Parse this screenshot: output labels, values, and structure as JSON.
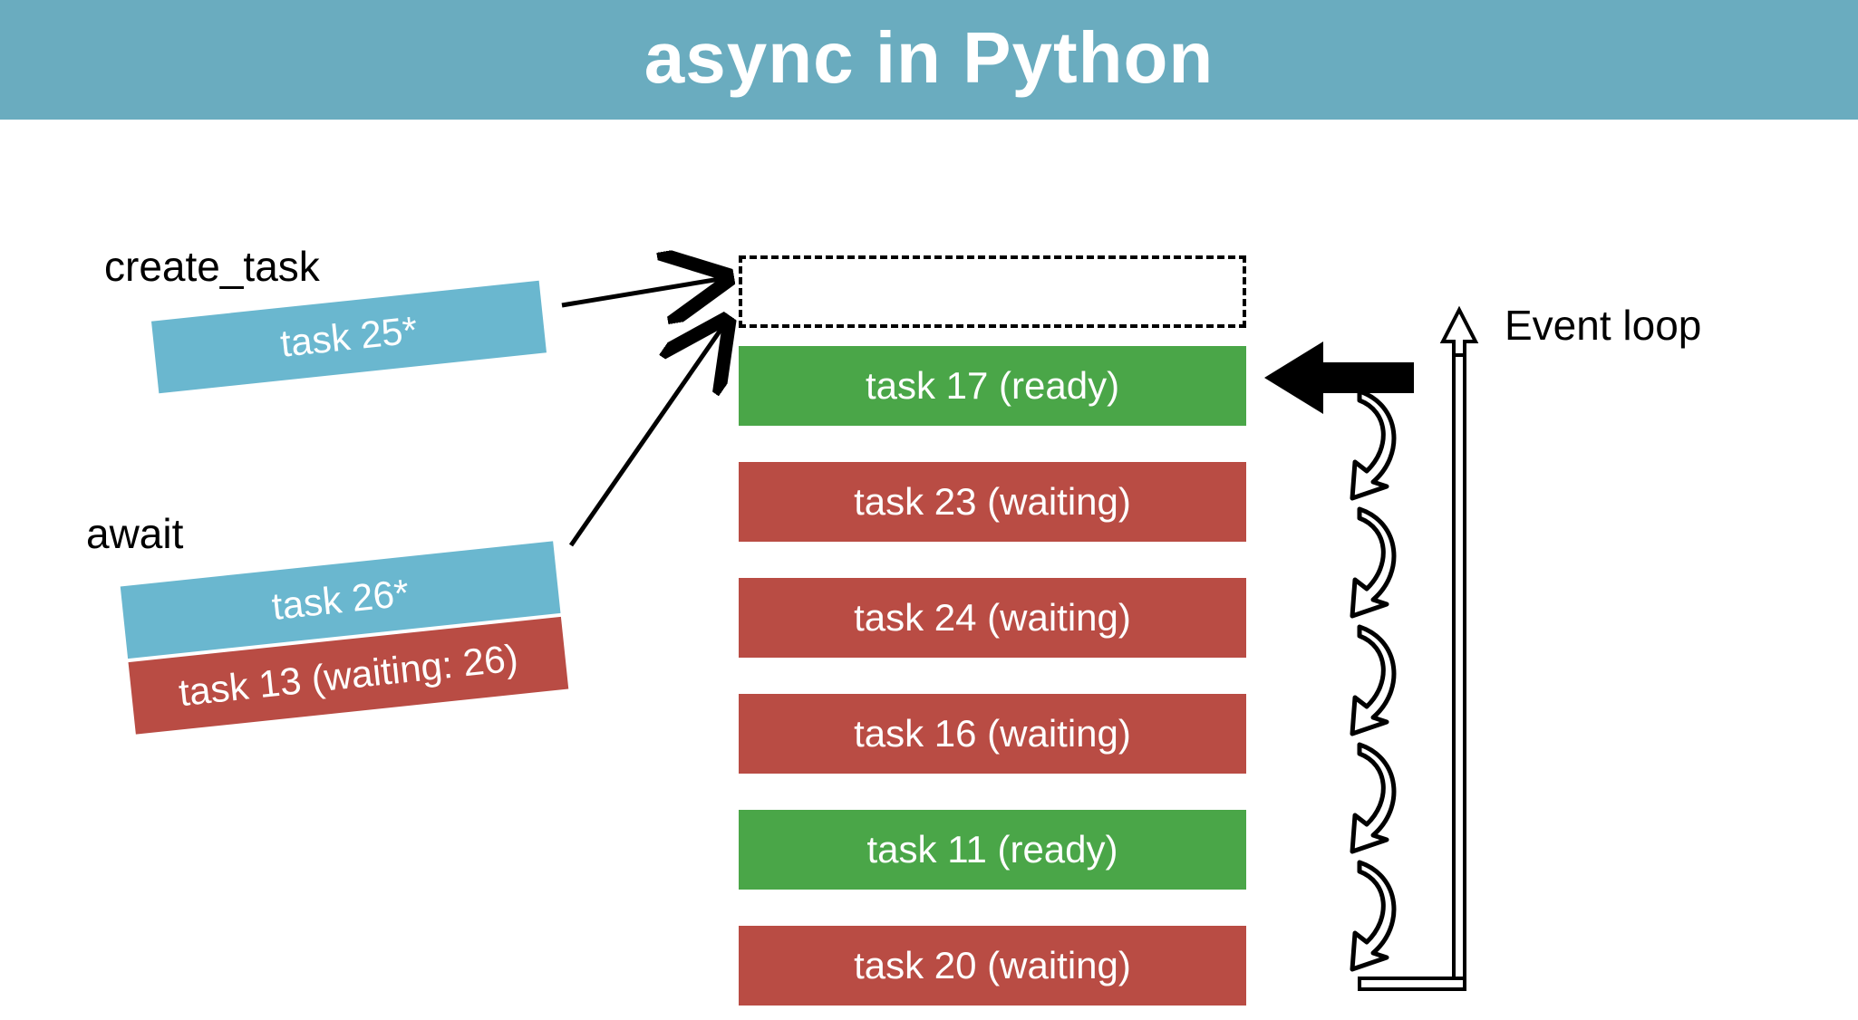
{
  "title": "async in Python",
  "labels": {
    "create_task": "create_task",
    "await": "await",
    "event_loop": "Event loop"
  },
  "left_tasks": {
    "create_task_box": "task 25*",
    "await_box_top": "task 26*",
    "await_box_bottom": "task 13 (waiting: 26)"
  },
  "queue": [
    {
      "text": "task 17 (ready)",
      "state": "ready"
    },
    {
      "text": "task 23 (waiting)",
      "state": "waiting"
    },
    {
      "text": "task 24 (waiting)",
      "state": "waiting"
    },
    {
      "text": "task 16 (waiting)",
      "state": "waiting"
    },
    {
      "text": "task 11 (ready)",
      "state": "ready"
    },
    {
      "text": "task 20 (waiting)",
      "state": "waiting"
    }
  ],
  "colors": {
    "title_bg": "#6aacbf",
    "blue": "#6ab7cf",
    "green": "#4aa648",
    "red": "#b94c44"
  }
}
